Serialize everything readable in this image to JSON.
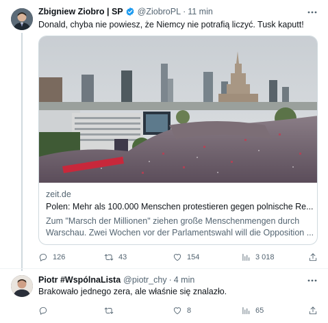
{
  "tweet1": {
    "author_name": "Zbigniew Ziobro | SP",
    "author_handle": "@ZiobroPL",
    "separator": "·",
    "time": "11 min",
    "text": "Donald, chyba nie powiesz, że Niemcy nie potrafią liczyć. Tusk kaputt!",
    "card": {
      "domain": "zeit.de",
      "title": "Polen: Mehr als 100.000 Menschen protestieren gegen polnische Re...",
      "description": "Zum \"Marsch der Millionen\" ziehen große Menschenmengen durch Warschau. Zwei Wochen vor der Parlamentswahl will die Opposition ..."
    },
    "stats": {
      "replies": "126",
      "retweets": "43",
      "likes": "154",
      "views": "3 018"
    }
  },
  "tweet2": {
    "author_name": "Piotr #WspólnaLista",
    "author_handle": "@piotr_chy",
    "separator": "·",
    "time": "4 min",
    "text": "Brakowało jednego zera, ale właśnie się znalazło.",
    "stats": {
      "replies": "",
      "retweets": "",
      "likes": "8",
      "views": "65"
    }
  },
  "icons": {
    "more": "more-horizontal-icon",
    "verified": "verified-badge-icon",
    "reply": "reply-icon",
    "retweet": "retweet-icon",
    "like": "heart-icon",
    "views": "views-chart-icon",
    "share": "share-icon"
  },
  "colors": {
    "text": "#0f1419",
    "muted": "#536471",
    "border": "#cfd9de",
    "verified": "#1d9bf0"
  }
}
